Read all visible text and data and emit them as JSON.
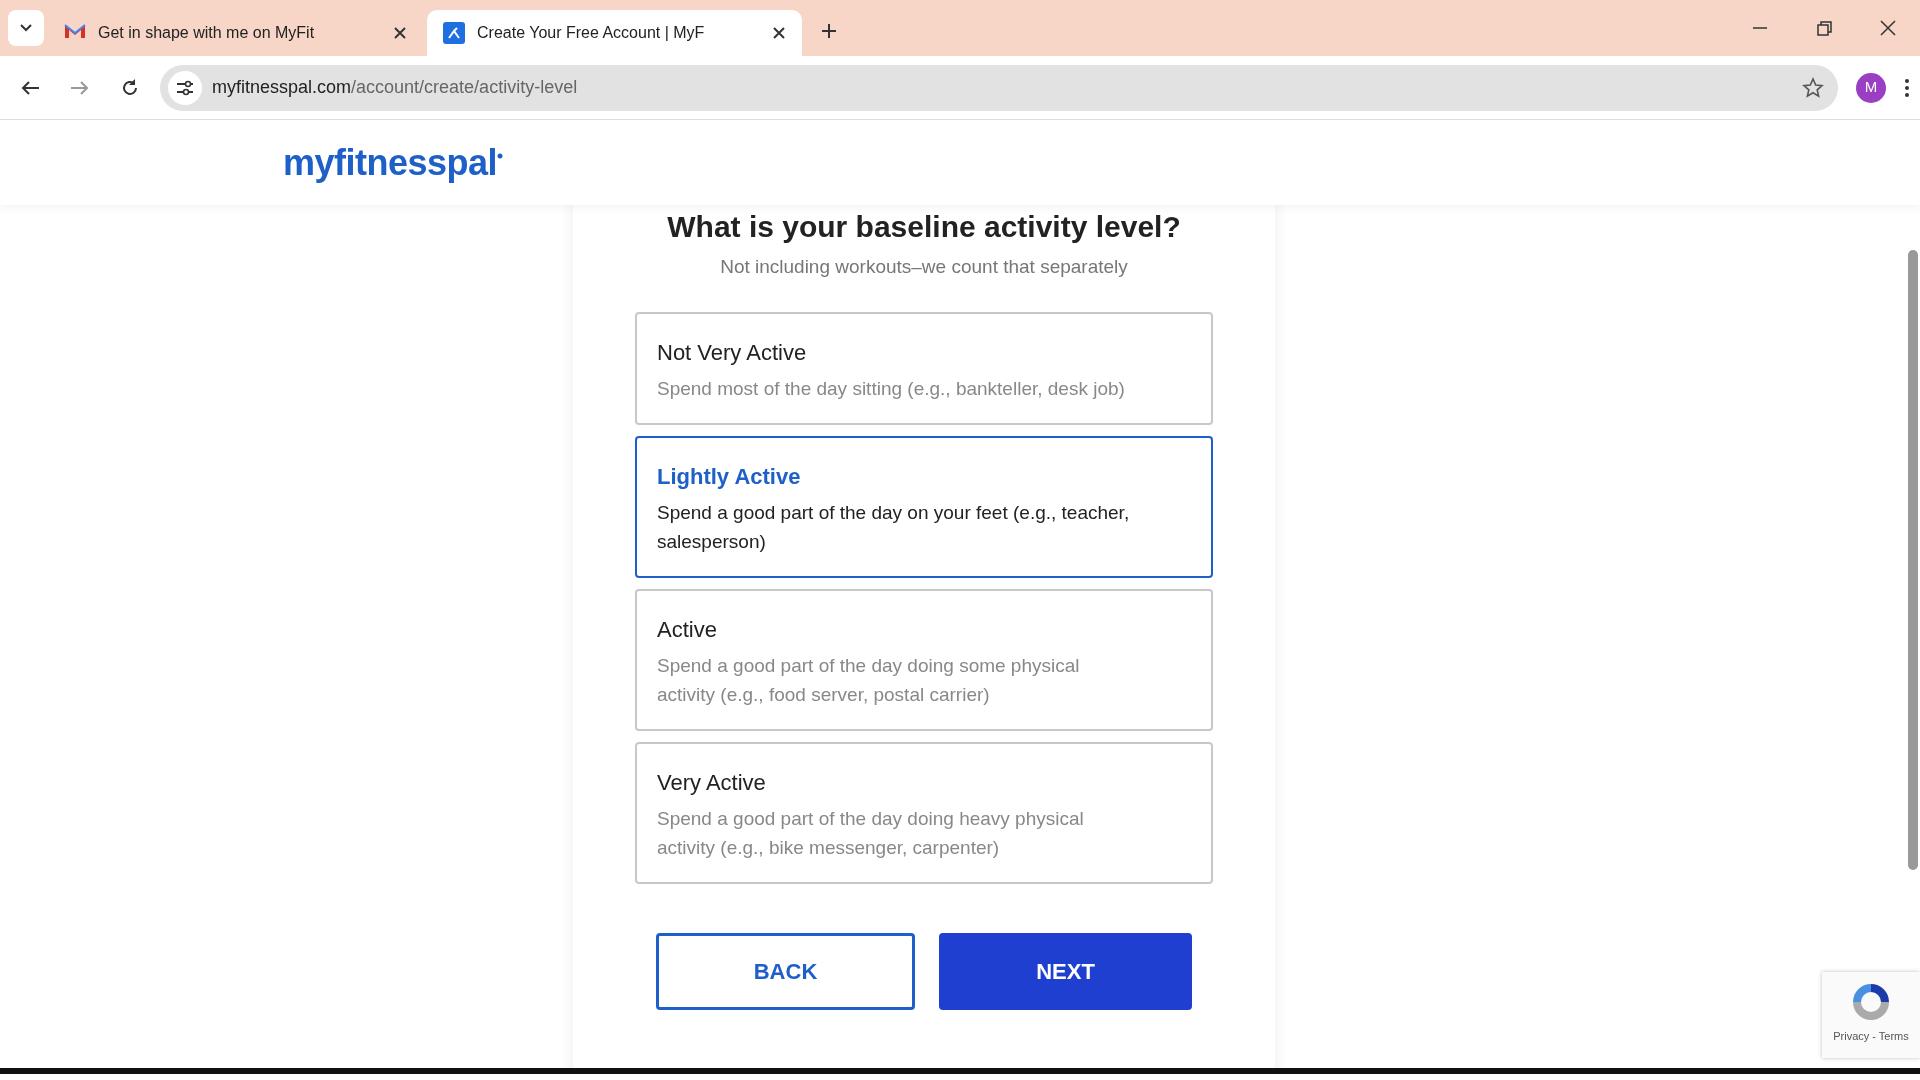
{
  "browser": {
    "tabs": [
      {
        "title": "Get in shape with me on MyFit",
        "selected": false
      },
      {
        "title": "Create Your Free Account | MyF",
        "selected": true
      }
    ],
    "url_host": "myfitnesspal.com",
    "url_path": "/account/create/activity-level",
    "profile_initial": "M"
  },
  "page": {
    "logo": "myfitnesspal",
    "heading": "What is your baseline activity level?",
    "subtitle": "Not including workouts–we count that separately",
    "options": [
      {
        "title": "Not Very Active",
        "description": "Spend most of the day sitting (e.g., bankteller, desk job)",
        "selected": false
      },
      {
        "title": "Lightly Active",
        "description": "Spend a good part of the day on your feet (e.g., teacher, salesperson)",
        "selected": true
      },
      {
        "title": "Active",
        "description": "Spend a good part of the day doing some physical activity (e.g., food server, postal carrier)",
        "selected": false
      },
      {
        "title": "Very Active",
        "description": "Spend a good part of the day doing heavy physical activity (e.g., bike messenger, carpenter)",
        "selected": false
      }
    ],
    "buttons": [
      {
        "label": "BACK",
        "kind": "secondary"
      },
      {
        "label": "NEXT",
        "kind": "primary"
      }
    ],
    "recaptcha": {
      "links": "Privacy - Terms"
    }
  }
}
